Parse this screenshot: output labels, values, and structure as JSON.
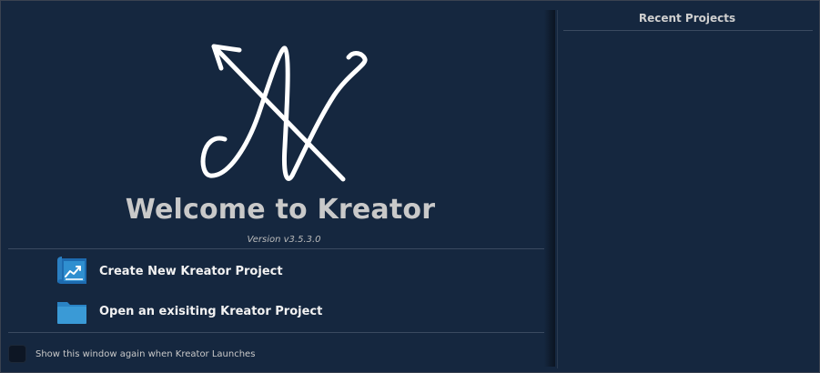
{
  "welcome": {
    "title": "Welcome to Kreator",
    "version": "Version v3.5.3.0"
  },
  "actions": [
    {
      "label": "Create New Kreator Project",
      "icon": "project-chart-icon"
    },
    {
      "label": "Open an exisiting Kreator Project",
      "icon": "folder-icon"
    }
  ],
  "footer": {
    "show_again_label": "Show this window again when Kreator Launches",
    "show_again_checked": false
  },
  "recent": {
    "title": "Recent Projects",
    "items": []
  },
  "colors": {
    "background": "#15273f",
    "accent_blue": "#2f8fd0",
    "text": "#f2f2f2"
  }
}
